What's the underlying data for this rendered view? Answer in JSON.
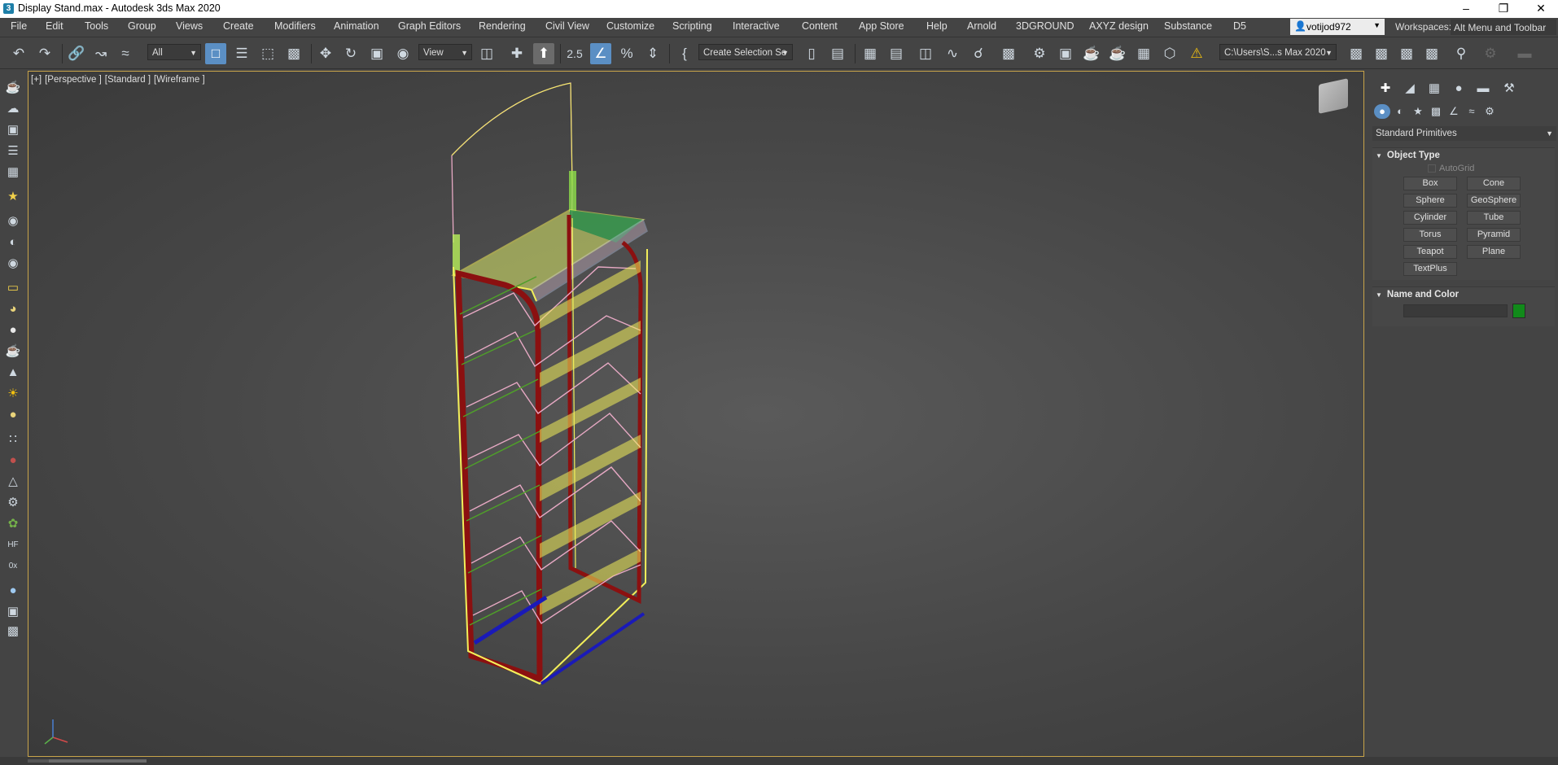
{
  "window": {
    "title": "Display Stand.max - Autodesk 3ds Max 2020",
    "app_icon": "3ds-max-icon"
  },
  "menu": [
    "File",
    "Edit",
    "Tools",
    "Group",
    "Views",
    "Create",
    "Modifiers",
    "Animation",
    "Graph Editors",
    "Rendering",
    "Civil View",
    "Customize",
    "Scripting",
    "Interactive",
    "Content",
    "App Store",
    "Help",
    "Arnold",
    "3DGROUND",
    "AXYZ design",
    "Substance",
    "D5"
  ],
  "user": {
    "name": "votijod972"
  },
  "workspaces": {
    "label": "Workspaces:",
    "value": "Alt Menu and Toolbar"
  },
  "toolbar": {
    "selection_filter": "All",
    "ref_coord": "View",
    "snap_value": "2.5",
    "named_selection_set": "Create Selection Se",
    "project_path": "C:\\Users\\S...s Max 2020"
  },
  "viewport": {
    "label_parts": [
      "[+]",
      "[Perspective ]",
      "[Standard ]",
      "[Wireframe ]"
    ],
    "axis_labels": {
      "x": "x",
      "y": "y",
      "z": "z"
    },
    "colors": {
      "frame_red": "#8b1010",
      "wire_yellow": "#f3ef5a",
      "wire_pink": "#e7a9c4",
      "wire_green": "#4f9e2a",
      "accent_blue": "#1a1ab8",
      "shelf_green": "#118a4a"
    }
  },
  "command_panel": {
    "category": "Standard Primitives",
    "object_type": {
      "title": "Object Type",
      "autogrid": "AutoGrid",
      "buttons": [
        "Box",
        "Cone",
        "Sphere",
        "GeoSphere",
        "Cylinder",
        "Tube",
        "Torus",
        "Pyramid",
        "Teapot",
        "Plane",
        "TextPlus"
      ]
    },
    "name_and_color": {
      "title": "Name and Color",
      "name_value": "",
      "color": "#118a1a"
    }
  }
}
